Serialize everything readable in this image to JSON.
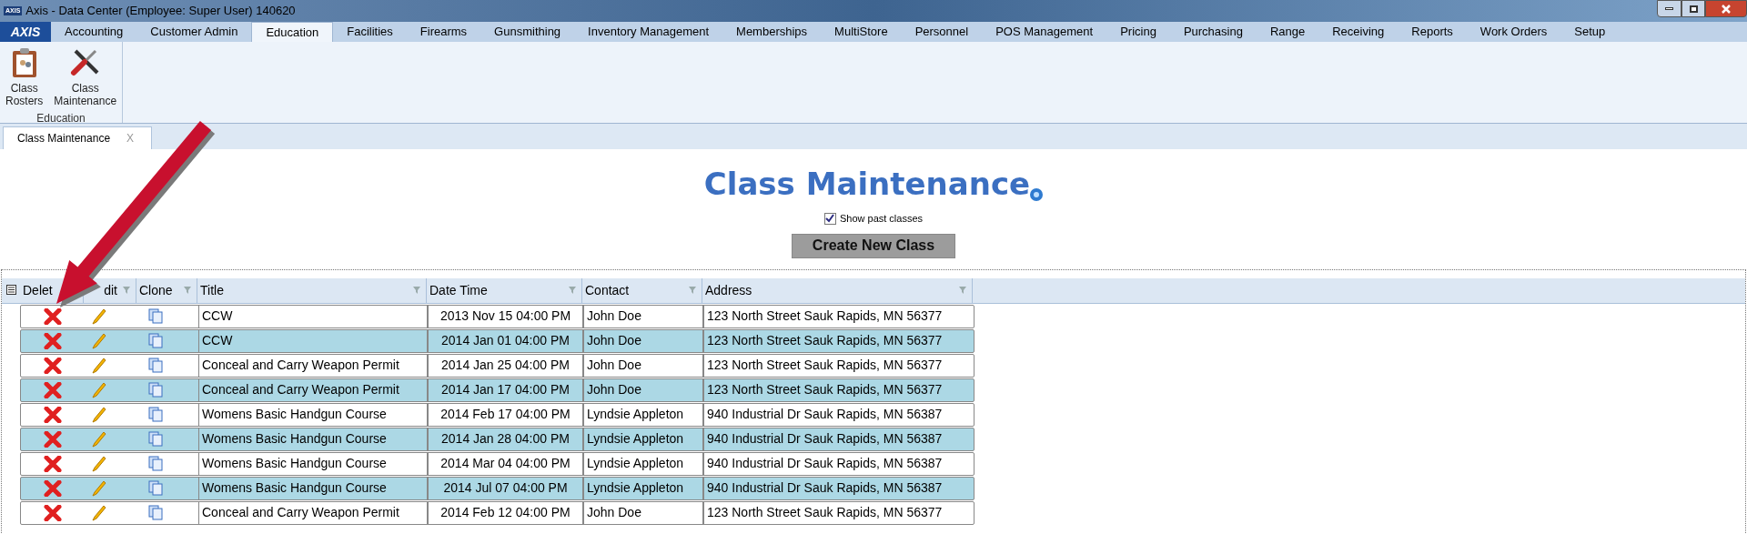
{
  "window": {
    "title": "Axis - Data Center  (Employee: Super User) 140620",
    "logo": "AXIS",
    "menu_logo": "AXIS"
  },
  "menu_tabs": [
    {
      "label": "Accounting",
      "selected": false
    },
    {
      "label": "Customer Admin",
      "selected": false
    },
    {
      "label": "Education",
      "selected": true
    },
    {
      "label": "Facilities",
      "selected": false
    },
    {
      "label": "Firearms",
      "selected": false
    },
    {
      "label": "Gunsmithing",
      "selected": false
    },
    {
      "label": "Inventory Management",
      "selected": false
    },
    {
      "label": "Memberships",
      "selected": false
    },
    {
      "label": "MultiStore",
      "selected": false
    },
    {
      "label": "Personnel",
      "selected": false
    },
    {
      "label": "POS Management",
      "selected": false
    },
    {
      "label": "Pricing",
      "selected": false
    },
    {
      "label": "Purchasing",
      "selected": false
    },
    {
      "label": "Range",
      "selected": false
    },
    {
      "label": "Receiving",
      "selected": false
    },
    {
      "label": "Reports",
      "selected": false
    },
    {
      "label": "Work Orders",
      "selected": false
    },
    {
      "label": "Setup",
      "selected": false
    }
  ],
  "ribbon": {
    "group": "Education",
    "buttons": [
      {
        "kind": "roster",
        "label": "Class Rosters"
      },
      {
        "kind": "tools",
        "label": "Class Maintenance"
      }
    ]
  },
  "doc_tabs": [
    {
      "label": "Class Maintenance",
      "close": "X",
      "selected": true
    }
  ],
  "page": {
    "title": "Class Maintenance",
    "show_past": {
      "label": "Show past classes",
      "checked": true
    },
    "create_button": "Create New Class"
  },
  "table": {
    "columns": [
      "Delet",
      "dit",
      "Clone",
      "Title",
      "Date Time",
      "Contact",
      "Address"
    ],
    "rows": [
      {
        "title": "CCW",
        "date_time": "2013 Nov 15 04:00 PM",
        "contact": "John Doe",
        "address": "123 North Street Sauk Rapids, MN 56377"
      },
      {
        "title": "CCW",
        "date_time": "2014 Jan 01 04:00 PM",
        "contact": "John Doe",
        "address": "123 North Street Sauk Rapids, MN 56377"
      },
      {
        "title": "Conceal and Carry Weapon Permit",
        "date_time": "2014 Jan 25 04:00 PM",
        "contact": "John Doe",
        "address": "123 North Street Sauk Rapids, MN 56377"
      },
      {
        "title": "Conceal and Carry Weapon Permit",
        "date_time": "2014 Jan 17 04:00 PM",
        "contact": "John Doe",
        "address": "123 North Street Sauk Rapids, MN 56377"
      },
      {
        "title": "Womens Basic Handgun Course",
        "date_time": "2014 Feb 17 04:00 PM",
        "contact": "Lyndsie Appleton",
        "address": "940 Industrial Dr Sauk Rapids, MN 56387"
      },
      {
        "title": "Womens Basic Handgun Course",
        "date_time": "2014 Jan 28 04:00 PM",
        "contact": "Lyndsie Appleton",
        "address": "940 Industrial Dr Sauk Rapids, MN 56387"
      },
      {
        "title": "Womens Basic Handgun Course",
        "date_time": "2014 Mar 04 04:00 PM",
        "contact": "Lyndsie Appleton",
        "address": "940 Industrial Dr Sauk Rapids, MN 56387"
      },
      {
        "title": "Womens Basic Handgun Course",
        "date_time": "2014 Jul 07 04:00 PM",
        "contact": "Lyndsie Appleton",
        "address": "940 Industrial Dr Sauk Rapids, MN 56387"
      },
      {
        "title": "Conceal and Carry Weapon Permit",
        "date_time": "2014 Feb 12 04:00 PM",
        "contact": "John Doe",
        "address": "123 North Street Sauk Rapids, MN 56377"
      }
    ]
  }
}
